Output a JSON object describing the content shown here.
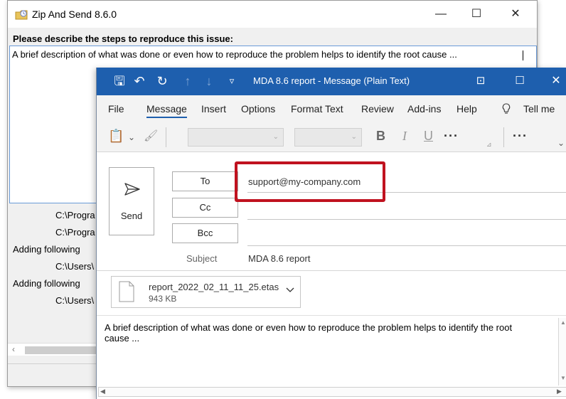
{
  "zip_window": {
    "title": "Zip And Send 8.6.0",
    "controls": {
      "minimize": "—",
      "maximize": "☐",
      "close": "✕"
    },
    "prompt": "Please describe the steps to reproduce this issue:",
    "description": "A brief description of what was done or even how to reproduce the problem helps to identify the root cause ...",
    "log": [
      {
        "text": "C:\\Progra",
        "indent": true
      },
      {
        "text": "C:\\Progra",
        "indent": true
      },
      {
        "text": "Adding following",
        "indent": false
      },
      {
        "text": "C:\\Users\\",
        "indent": true
      },
      {
        "text": "Adding following",
        "indent": false
      },
      {
        "text": "C:\\Users\\",
        "indent": true
      }
    ],
    "scroll_left": "‹"
  },
  "outlook": {
    "title": "MDA 8.6 report  -  Message (Plain Text)",
    "titlebar_icons": {
      "save": "🖫",
      "undo": "↶",
      "redo": "↻",
      "up": "↑",
      "down": "↓",
      "customize": "▿",
      "ribbon": "⊡",
      "maximize": "☐",
      "close": "✕"
    },
    "menu": [
      "File",
      "Message",
      "Insert",
      "Options",
      "Format Text",
      "Review",
      "Add-ins",
      "Help",
      "Tell me"
    ],
    "active_menu": "Message",
    "toolbar": {
      "paste": "📋",
      "dropdown": "⌄",
      "format_painter": "🖌",
      "bold": "B",
      "italic": "I",
      "underline": "U",
      "more": "···",
      "more2": "···",
      "launcher": "⊿",
      "collapse": "⌄"
    },
    "send_label": "Send",
    "to_label": "To",
    "cc_label": "Cc",
    "bcc_label": "Bcc",
    "to_value": "support@my-company.com",
    "subject_label": "Subject",
    "subject_value": "MDA 8.6 report",
    "attachment": {
      "name": "report_2022_02_11_11_25.etas",
      "size": "943 KB"
    },
    "body": "A brief description of what was done or even how to reproduce the problem helps to identify the root cause ...",
    "scroll": {
      "left": "◀",
      "right": "▶",
      "up": "▲",
      "down": "▼"
    }
  },
  "colors": {
    "outlook_blue": "#1e5fae",
    "highlight_red": "#c0121f"
  }
}
